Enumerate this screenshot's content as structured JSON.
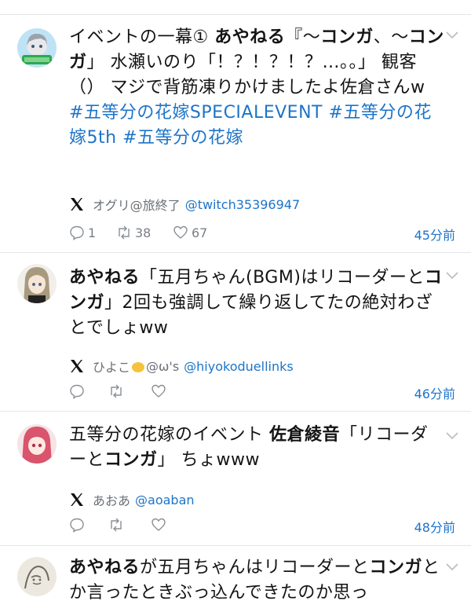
{
  "tweets": [
    {
      "avatar": "avatar-ogri",
      "text_parts": [
        {
          "t": "イベントの一幕① ",
          "s": "n"
        },
        {
          "t": "あやねる",
          "s": "b"
        },
        {
          "t": "『〜",
          "s": "n"
        },
        {
          "t": "コンガ",
          "s": "b"
        },
        {
          "t": "、〜",
          "s": "n"
        },
        {
          "t": "コンガ",
          "s": "b"
        },
        {
          "t": "」 水瀬いのり「！？！？！？…。。」 観客（） マジで背筋凍りかけましたよ佐倉さんw ",
          "s": "n"
        },
        {
          "t": "#五等分の花嫁SPECIALEVENT",
          "s": "h"
        },
        {
          "t": " ",
          "s": "n"
        },
        {
          "t": "#五等分の花嫁5th",
          "s": "h"
        },
        {
          "t": " ",
          "s": "n"
        },
        {
          "t": "#五等分の花嫁",
          "s": "h"
        }
      ],
      "source_name": "オグリ@旅終了",
      "source_handle": "@twitch35396947",
      "replies": "1",
      "retweets": "38",
      "likes": "67",
      "time": "45分前"
    },
    {
      "avatar": "avatar-hiyoko",
      "text_parts": [
        {
          "t": "あやねる",
          "s": "b"
        },
        {
          "t": "「五月ちゃん(BGM)はリコーダーと",
          "s": "n"
        },
        {
          "t": "コンガ",
          "s": "b"
        },
        {
          "t": "」2回も強調して繰り返してたの絶対わざとでしょww",
          "s": "n"
        }
      ],
      "source_name_pre": "ひよこ",
      "source_name_post": "@ω's",
      "source_handle": "@hiyokoduellinks",
      "replies": "",
      "retweets": "",
      "likes": "",
      "time": "46分前"
    },
    {
      "avatar": "avatar-aoaba",
      "text_parts": [
        {
          "t": "五等分の花嫁のイベント ",
          "s": "n"
        },
        {
          "t": "佐倉綾音",
          "s": "b"
        },
        {
          "t": "「リコーダーと",
          "s": "n"
        },
        {
          "t": "コンガ",
          "s": "b"
        },
        {
          "t": "」 ちょwww",
          "s": "n"
        }
      ],
      "source_name": "あおあ",
      "source_handle": "@aoaban",
      "replies": "",
      "retweets": "",
      "likes": "",
      "time": "48分前"
    },
    {
      "avatar": "avatar-sketch",
      "text_parts": [
        {
          "t": "あやねる",
          "s": "b"
        },
        {
          "t": "が五月ちゃんはリコーダーと",
          "s": "n"
        },
        {
          "t": "コンガ",
          "s": "b"
        },
        {
          "t": "とか言ったときぶっ込んできたのか思っ",
          "s": "n"
        }
      ]
    }
  ],
  "colors": {
    "link": "#1d74c8",
    "muted": "#7a7f84",
    "divider": "#e2e6ea"
  },
  "icons": [
    "x-logo-icon",
    "reply-icon",
    "retweet-icon",
    "like-icon",
    "chevron-down-icon"
  ]
}
